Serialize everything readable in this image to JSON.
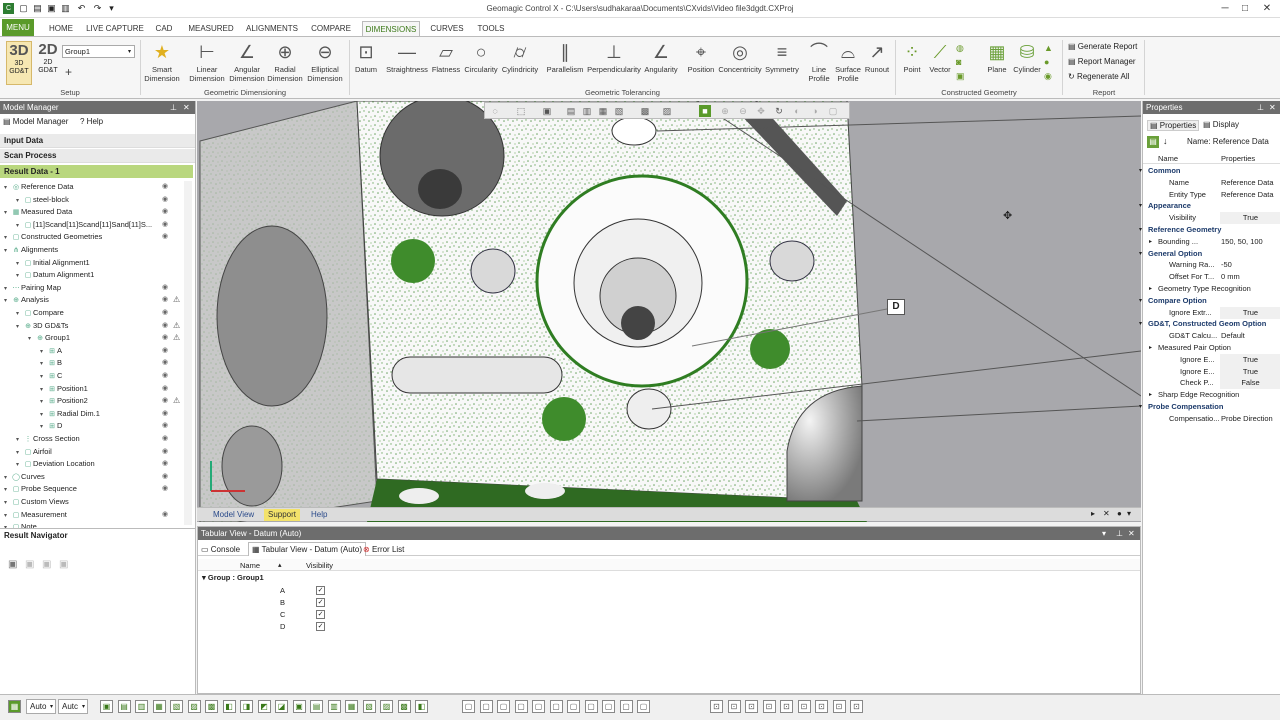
{
  "app": {
    "title": "Geomagic Control X - C:\\Users\\sudhakaraa\\Documents\\CXvids\\Video file3dgdt.CXProj"
  },
  "ribbon_tabs": [
    "MENU",
    "HOME",
    "LIVE CAPTURE",
    "CAD",
    "MEASURED",
    "ALIGNMENTS",
    "COMPARE",
    "DIMENSIONS",
    "CURVES",
    "TOOLS"
  ],
  "ribbon": {
    "setup": {
      "btn3d": "3D",
      "btn3d_sub": "3D GD&T",
      "btn2d": "2D",
      "btn2d_sub": "2D GD&T",
      "group_value": "Group1",
      "label": "Setup"
    },
    "geo_dim": {
      "items": [
        "Smart Dimension",
        "Linear Dimension",
        "Angular Dimension",
        "Radial Dimension",
        "Elliptical Dimension"
      ],
      "label": "Geometric Dimensioning"
    },
    "geo_tol": {
      "items": [
        "Datum",
        "Straightness",
        "Flatness",
        "Circularity",
        "Cylindricity",
        "Parallelism",
        "Perpendicularity",
        "Angularity",
        "Position",
        "Concentricity",
        "Symmetry",
        "Line Profile",
        "Surface Profile",
        "Runout"
      ],
      "label": "Geometric Tolerancing"
    },
    "constructed": {
      "items": [
        "Point",
        "Vector",
        "Plane",
        "Cylinder"
      ],
      "label": "Constructed Geometry"
    },
    "report": {
      "items": [
        "Generate Report",
        "Report Manager",
        "Regenerate All"
      ],
      "label": "Report"
    }
  },
  "model_manager": {
    "title": "Model Manager",
    "tabs": [
      "Model Manager",
      "Help"
    ],
    "sections": [
      "Input Data",
      "Scan Process",
      "Result Data - 1"
    ],
    "tree": [
      {
        "label": "Reference Data",
        "indent": 0,
        "eye": true,
        "warn": false
      },
      {
        "label": "steel-block",
        "indent": 1,
        "eye": true,
        "warn": false
      },
      {
        "label": "Measured Data",
        "indent": 0,
        "eye": true,
        "warn": false
      },
      {
        "label": "[11]Scand[11]Scand[11]Sand[11]S...",
        "indent": 1,
        "eye": true,
        "warn": false
      },
      {
        "label": "Constructed Geometries",
        "indent": 0,
        "eye": true,
        "warn": false
      },
      {
        "label": "Alignments",
        "indent": 0,
        "eye": false,
        "warn": false
      },
      {
        "label": "Initial Alignment1",
        "indent": 1,
        "eye": false,
        "warn": false
      },
      {
        "label": "Datum Alignment1",
        "indent": 1,
        "eye": false,
        "warn": false
      },
      {
        "label": "Pairing Map",
        "indent": 0,
        "eye": true,
        "warn": false
      },
      {
        "label": "Analysis",
        "indent": 0,
        "eye": true,
        "warn": true
      },
      {
        "label": "Compare",
        "indent": 1,
        "eye": true,
        "warn": false
      },
      {
        "label": "3D GD&Ts",
        "indent": 1,
        "eye": true,
        "warn": true
      },
      {
        "label": "Group1",
        "indent": 2,
        "eye": true,
        "warn": true
      },
      {
        "label": "A",
        "indent": 3,
        "eye": true,
        "warn": false
      },
      {
        "label": "B",
        "indent": 3,
        "eye": true,
        "warn": false
      },
      {
        "label": "C",
        "indent": 3,
        "eye": true,
        "warn": false
      },
      {
        "label": "Position1",
        "indent": 3,
        "eye": true,
        "warn": false
      },
      {
        "label": "Position2",
        "indent": 3,
        "eye": true,
        "warn": true
      },
      {
        "label": "Radial Dim.1",
        "indent": 3,
        "eye": true,
        "warn": false
      },
      {
        "label": "D",
        "indent": 3,
        "eye": true,
        "warn": false
      },
      {
        "label": "Cross Section",
        "indent": 1,
        "eye": true,
        "warn": false
      },
      {
        "label": "Airfoil",
        "indent": 1,
        "eye": true,
        "warn": false
      },
      {
        "label": "Deviation Location",
        "indent": 1,
        "eye": true,
        "warn": false
      },
      {
        "label": "Curves",
        "indent": 0,
        "eye": true,
        "warn": false
      },
      {
        "label": "Probe Sequence",
        "indent": 0,
        "eye": true,
        "warn": false
      },
      {
        "label": "Custom Views",
        "indent": 0,
        "eye": false,
        "warn": false
      },
      {
        "label": "Measurement",
        "indent": 0,
        "eye": true,
        "warn": false
      },
      {
        "label": "Note",
        "indent": 0,
        "eye": false,
        "warn": false
      }
    ]
  },
  "result_navigator": {
    "title": "Result Navigator"
  },
  "viewport": {
    "datum_label": "D",
    "tabs": [
      "Model View",
      "Support",
      "Help"
    ]
  },
  "tabular": {
    "title": "Tabular View - Datum (Auto)",
    "tabs": [
      "Console",
      "Tabular View - Datum (Auto)",
      "Error List"
    ],
    "columns": [
      "Name",
      "Visibility"
    ],
    "group": "Group : Group1",
    "rows": [
      "A",
      "B",
      "C",
      "D"
    ]
  },
  "properties": {
    "title": "Properties",
    "tabs": [
      "Properties",
      "Display"
    ],
    "name_field": "Name: Reference Data",
    "columns": [
      "Name",
      "Properties"
    ],
    "rows": [
      {
        "type": "cat",
        "name": "Common"
      },
      {
        "type": "row",
        "name": "Name",
        "value": "Reference Data"
      },
      {
        "type": "row",
        "name": "Entity Type",
        "value": "Reference Data"
      },
      {
        "type": "cat",
        "name": "Appearance"
      },
      {
        "type": "row",
        "name": "Visibility",
        "value": "True",
        "box": true
      },
      {
        "type": "cat",
        "name": "Reference Geometry"
      },
      {
        "type": "sub",
        "name": "Bounding ...",
        "value": "150, 50, 100"
      },
      {
        "type": "cat",
        "name": "General Option"
      },
      {
        "type": "row",
        "name": "Warning Ra...",
        "value": "-50"
      },
      {
        "type": "row",
        "name": "Offset For T...",
        "value": "0 mm"
      },
      {
        "type": "sub",
        "name": "Geometry Type Recognition",
        "value": ""
      },
      {
        "type": "cat",
        "name": "Compare Option"
      },
      {
        "type": "row",
        "name": "Ignore Extr...",
        "value": "True",
        "box": true
      },
      {
        "type": "cat",
        "name": "GD&T, Constructed Geom Option"
      },
      {
        "type": "row",
        "name": "GD&T Calcu...",
        "value": "Default"
      },
      {
        "type": "sub",
        "name": "Measured Pair Option",
        "value": ""
      },
      {
        "type": "row2",
        "name": "Ignore E...",
        "value": "True",
        "box": true
      },
      {
        "type": "row2",
        "name": "Ignore E...",
        "value": "True",
        "box": true
      },
      {
        "type": "row2",
        "name": "Check P...",
        "value": "False",
        "box": true
      },
      {
        "type": "sub",
        "name": "Sharp Edge Recognition",
        "value": ""
      },
      {
        "type": "cat",
        "name": "Probe Compensation"
      },
      {
        "type": "row",
        "name": "Compensatio...",
        "value": "Probe Direction"
      }
    ]
  },
  "statusbar": {
    "sel1": "Auto",
    "sel2": "Autc"
  },
  "colors": {
    "accent": "#5a9a2a",
    "scan_green": "#2f7d22",
    "link_blue": "#2a4a8a"
  }
}
